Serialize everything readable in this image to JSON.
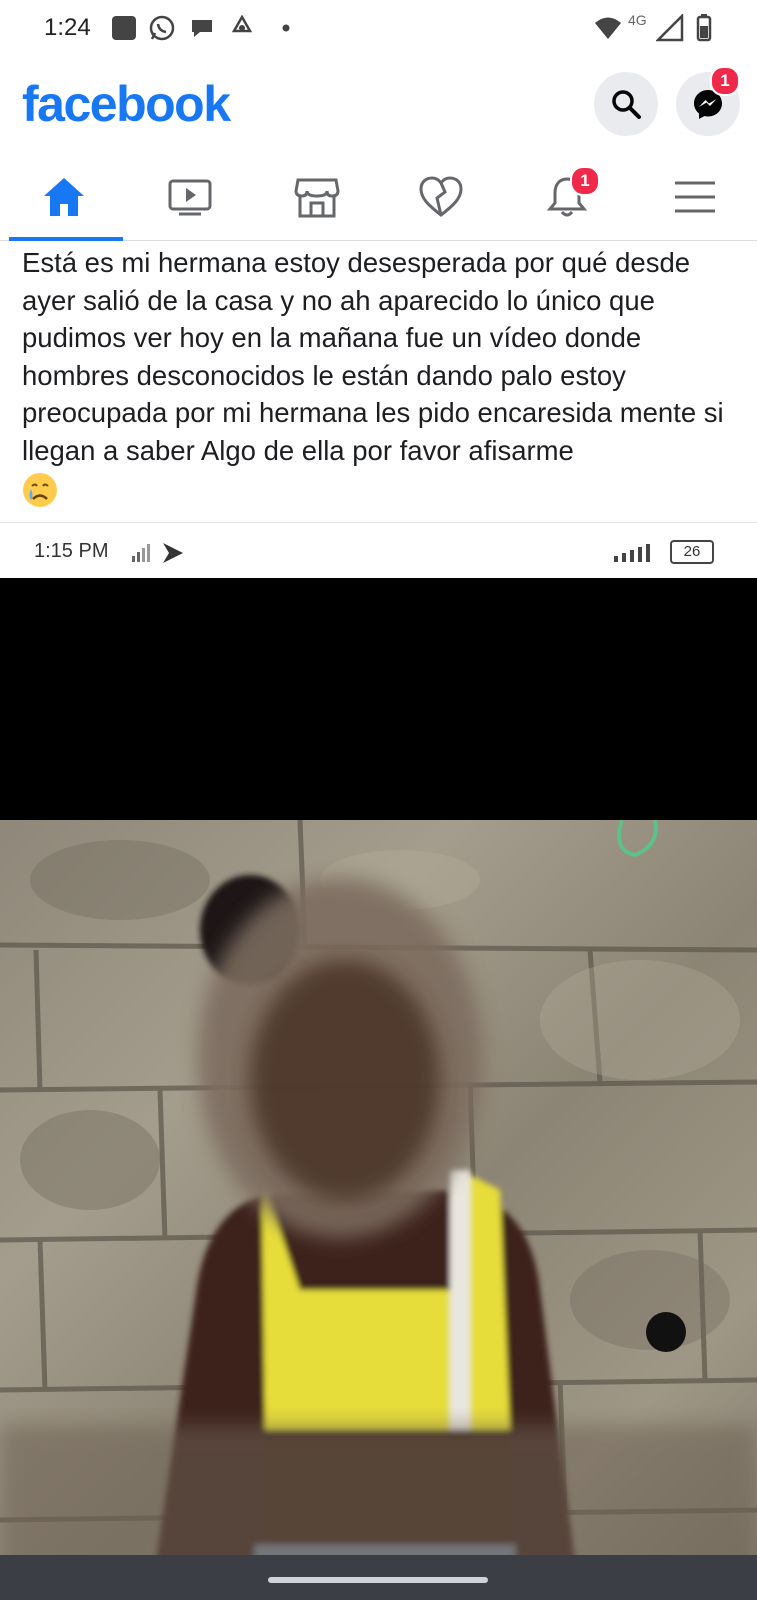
{
  "status_bar": {
    "time": "1:24",
    "network": "4G"
  },
  "header": {
    "logo_text": "facebook",
    "messenger_badge": "1"
  },
  "nav": {
    "items": [
      "home",
      "watch",
      "marketplace",
      "dating",
      "notifications",
      "menu"
    ],
    "notifications_badge": "1",
    "active": "home"
  },
  "post": {
    "text": "Está es mi hermana estoy desesperada por qué desde ayer salió de la casa y no ah aparecido lo único que pudimos ver hoy en la mañana fue un vídeo donde hombres desconocidos le están dando palo estoy preocupada por mi hermana les pido encaresida mente si llegan a saber Algo de ella por favor afisarme",
    "emoji": "crying-face"
  },
  "screenshot_status": {
    "time": "1:15 PM",
    "battery": "26"
  },
  "colors": {
    "brand": "#1877f2",
    "badge": "#f02849",
    "text": "#1c1e21"
  }
}
